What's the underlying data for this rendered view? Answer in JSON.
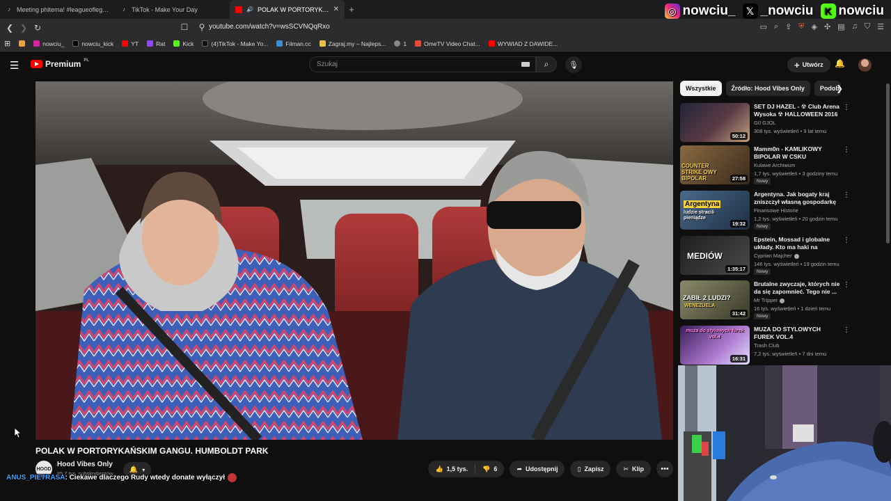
{
  "browser": {
    "tabs": [
      {
        "title": "Meeting phitema! #leagueoflegends",
        "icon_color": "#1a1a1a",
        "active": false
      },
      {
        "title": "TikTok - Make Your Day",
        "icon_color": "#1a1a1a",
        "active": false
      },
      {
        "title": "POLAK W PORTORYKAŃSKIM",
        "icon_color": "#ff0000",
        "active": true
      }
    ],
    "url": "youtube.com/watch?v=wsSCVNQqRxo",
    "bookmarks": [
      {
        "label": "",
        "color": "#e8a33a"
      },
      {
        "label": "nowciu_",
        "color": "#d6249f"
      },
      {
        "label": "nowciu_kick",
        "color": "#000000"
      },
      {
        "label": "YT",
        "color": "#ff0000"
      },
      {
        "label": "Rat",
        "color": "#9146ff"
      },
      {
        "label": "Kick",
        "color": "#53fc18"
      },
      {
        "label": "(4)TikTok - Make Yo...",
        "color": "#111111"
      },
      {
        "label": "Filman.cc",
        "color": "#3a8fd9"
      },
      {
        "label": "Zagraj.my – Najleps...",
        "color": "#f0c040"
      },
      {
        "label": "1",
        "color": "#888888"
      },
      {
        "label": "OmeTV Video Chat...",
        "color": "#e34b3b"
      },
      {
        "label": "WYWIAD Z DAWIDE...",
        "color": "#ff0000"
      }
    ]
  },
  "overlay": {
    "instagram": "nowciu_",
    "x": "_nowciu",
    "kick": "nowciu"
  },
  "youtube": {
    "logo_text": "Premium",
    "region": "PL",
    "search_placeholder": "Szukaj",
    "create_label": "Utwórz"
  },
  "video": {
    "title": "POLAK W PORTORYKAŃSKIM GANGU. HUMBOLDT PARK",
    "channel": "Hood Vibes Only",
    "subscribers": "85,7 tys. subskrybentów",
    "avatar_text": "HOOD",
    "likes": "1,5 tys.",
    "dislikes": "6",
    "share_label": "Udostępnij",
    "save_label": "Zapisz",
    "clip_label": "Klip"
  },
  "chat": {
    "user": "ANUS_PIETRASA",
    "message": ": Ciekawe dlaczego Rudy wtedy donate wyłączył"
  },
  "sidebar": {
    "chips": [
      "Wszystkie",
      "Źródło: Hood Vibes Only",
      "Podobne"
    ],
    "videos": [
      {
        "title": "SET DJ HAZEL - ☢ Club Arena Wysoka ☢ HALLOWEEN 2016 ...",
        "channel": "G0 GJOL",
        "meta": "308 tys. wyświetleń • 9 lat temu",
        "duration": "50:12",
        "badge": "",
        "verified": false,
        "thumb": "#3a3f55"
      },
      {
        "title": "Mamm0n - KAMLIKOWY BIPOLAR W CSKU",
        "channel": "Kulawe Archiwum",
        "meta": "1,7 tys. wyświetleń • 3 godziny temu",
        "duration": "27:58",
        "badge": "Nowy",
        "verified": false,
        "thumb": "#6b4a2a"
      },
      {
        "title": "Argentyna. Jak bogaty kraj zniszczył własną gospodarkę",
        "channel": "Finansowe Historie",
        "meta": "1,2 tys. wyświetleń • 20 godzin temu",
        "duration": "19:32",
        "badge": "Nowy",
        "verified": false,
        "thumb": "#2b4a6b"
      },
      {
        "title": "Epstein, Mossad i globalne układy. Kto ma haki na polskie...",
        "channel": "Cyprian Majcher",
        "meta": "146 tys. wyświetleń • 19 godzin temu",
        "duration": "1:35:17",
        "badge": "Nowy",
        "verified": true,
        "thumb": "#2a2a2a"
      },
      {
        "title": "Brutalne zwyczaje, których nie da się zapomnieć. Tego nie ...",
        "channel": "Mr Tripper",
        "meta": "16 tys. wyświetleń • 1 dzień temu",
        "duration": "31:42",
        "badge": "Nowy",
        "verified": true,
        "thumb": "#6a6a50"
      },
      {
        "title": "MUZA DO STYLOWYCH FUREK VOL.4",
        "channel": "Trash Club",
        "meta": "7,2 tys. wyświetleń • 7 dni temu",
        "duration": "16:31",
        "badge": "",
        "verified": false,
        "thumb": "#4a2a6b"
      }
    ]
  },
  "thumb_text": {
    "v2": "COUNTER STRIKE OWY BIPOLAR",
    "v3_a": "Argentyna",
    "v3_b": "ludzie stracili pieniądze",
    "v4": "MEDIÓW",
    "v5_a": "ZABIŁ 2 LUDZI?",
    "v5_b": "WENEZUELA",
    "v6": "muza do stylowych furek vol.4"
  }
}
